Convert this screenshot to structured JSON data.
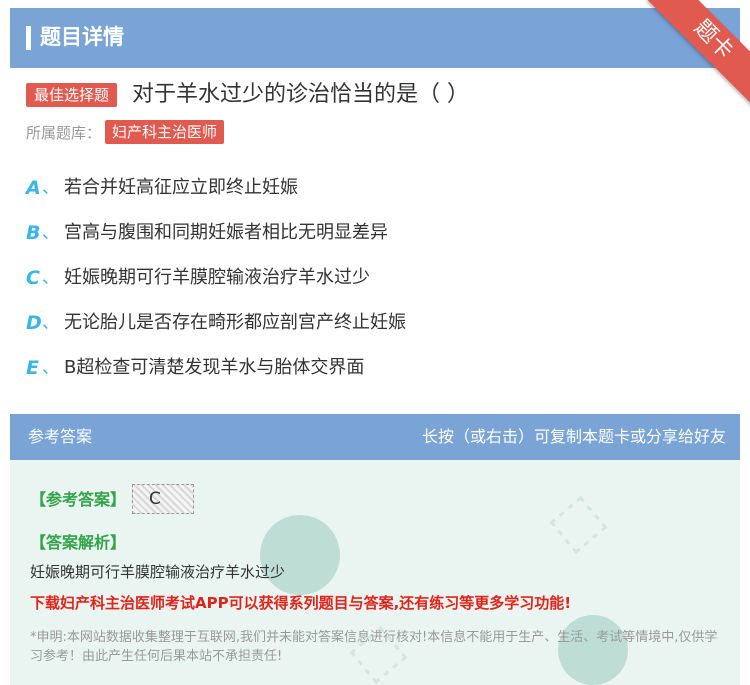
{
  "header": {
    "title": "题目详情"
  },
  "ribbon": {
    "label": "题卡"
  },
  "question": {
    "type_badge": "最佳选择题",
    "text": "对于羊水过少的诊治恰当的是（ ）"
  },
  "library": {
    "label": "所属题库：",
    "tag": "妇产科主治医师"
  },
  "options": [
    {
      "letter": "A",
      "sep": "、",
      "text": "若合并妊高征应立即终止妊娠"
    },
    {
      "letter": "B",
      "sep": "、",
      "text": "宫高与腹围和同期妊娠者相比无明显差异"
    },
    {
      "letter": "C",
      "sep": "、",
      "text": "妊娠晚期可行羊膜腔输液治疗羊水过少"
    },
    {
      "letter": "D",
      "sep": "、",
      "text": "无论胎儿是否存在畸形都应剖宫产终止妊娠"
    },
    {
      "letter": "E",
      "sep": "、",
      "text": "B超检查可清楚发现羊水与胎体交界面"
    }
  ],
  "answer_section": {
    "title": "参考答案",
    "hint": "长按（或右击）可复制本题卡或分享给好友",
    "answer_label": "【参考答案】",
    "answer_value": "C",
    "explanation_label": "【答案解析】",
    "explanation_text": "妊娠晚期可行羊膜腔输液治疗羊水过少",
    "promo": "下载妇产科主治医师考试APP可以获得系列题目与答案,还有练习等更多学习功能!",
    "disclaimer": "*申明:本网站数据收集整理于互联网,我们并未能对答案信息进行核对!本信息不能用于生产、生活、考试等情境中,仅供学习参考！由此产生任何后果本站不承担责任!"
  },
  "colors": {
    "header_bg": "#7aa3d6",
    "badge_red": "#e05a4f",
    "option_letter": "#38b6e8",
    "answer_green": "#35a34a",
    "promo_red": "#e2231a",
    "answer_bg": "#eaf5f1"
  }
}
